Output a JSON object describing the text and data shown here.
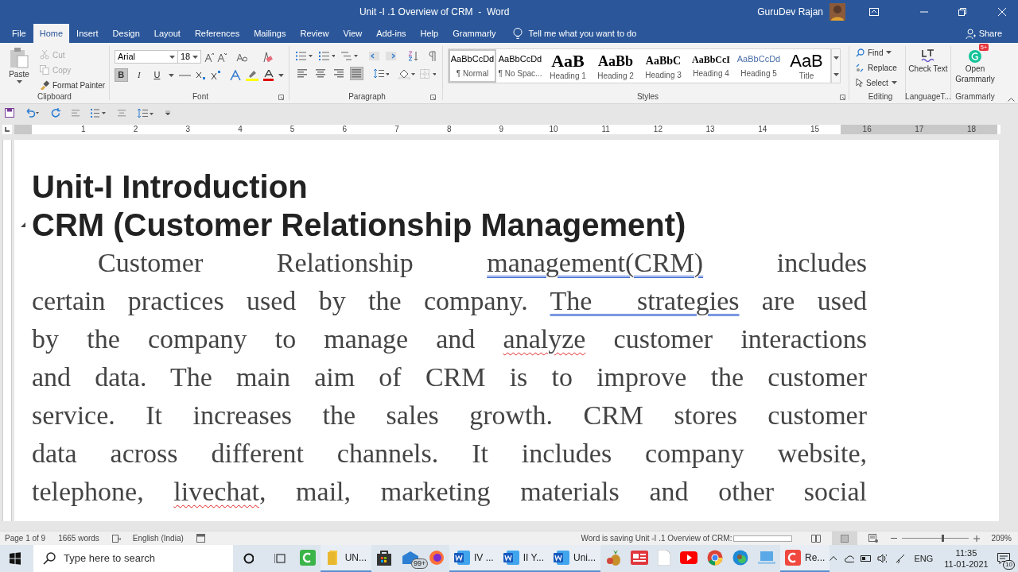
{
  "window": {
    "title": "Unit -I .1 Overview of CRM  -  Word",
    "user": "GuruDev Rajan"
  },
  "menu_tabs": [
    {
      "label": "File",
      "selected": false
    },
    {
      "label": "Home",
      "selected": true
    },
    {
      "label": "Insert",
      "selected": false
    },
    {
      "label": "Design",
      "selected": false
    },
    {
      "label": "Layout",
      "selected": false
    },
    {
      "label": "References",
      "selected": false
    },
    {
      "label": "Mailings",
      "selected": false
    },
    {
      "label": "Review",
      "selected": false
    },
    {
      "label": "View",
      "selected": false
    },
    {
      "label": "Add-ins",
      "selected": false
    },
    {
      "label": "Help",
      "selected": false
    },
    {
      "label": "Grammarly",
      "selected": false
    }
  ],
  "tell_me": "Tell me what you want to do",
  "share": "Share",
  "clipboard": {
    "paste": "Paste",
    "items": [
      {
        "kind": "cut",
        "label": "Cut",
        "disabled": true
      },
      {
        "kind": "copy",
        "label": "Copy",
        "disabled": true
      },
      {
        "kind": "painter",
        "label": "Format Painter",
        "disabled": false
      }
    ],
    "label": "Clipboard"
  },
  "font": {
    "name": "Arial",
    "size": "18",
    "label": "Font",
    "formats": [
      {
        "kind": "bold",
        "label": "B",
        "on": true
      },
      {
        "kind": "italic",
        "label": "I",
        "on": false
      },
      {
        "kind": "underline",
        "label": "U",
        "on": false
      }
    ]
  },
  "paragraph": {
    "label": "Paragraph",
    "alignments": [
      {
        "kind": "left",
        "selected": false
      },
      {
        "kind": "center",
        "selected": false
      },
      {
        "kind": "right",
        "selected": false
      },
      {
        "kind": "justify",
        "selected": true
      }
    ]
  },
  "styles": {
    "label": "Styles",
    "items": [
      {
        "kind": "normal",
        "preview": "AaBbCcDd",
        "name": "¶ Normal",
        "selected": true
      },
      {
        "kind": "nospacing",
        "preview": "AaBbCcDd",
        "name": "¶ No Spac...",
        "selected": false
      },
      {
        "kind": "h1",
        "preview": "AaB",
        "name": "Heading 1",
        "selected": false
      },
      {
        "kind": "h2",
        "preview": "AaBb",
        "name": "Heading 2",
        "selected": false
      },
      {
        "kind": "h3",
        "preview": "AaBbC",
        "name": "Heading 3",
        "selected": false
      },
      {
        "kind": "h4",
        "preview": "AaBbCcI",
        "name": "Heading 4",
        "selected": false
      },
      {
        "kind": "h5",
        "preview": "AaBbCcDd",
        "name": "Heading 5",
        "selected": false
      },
      {
        "kind": "title",
        "preview": "AaB",
        "name": "Title",
        "selected": false
      }
    ]
  },
  "editing": {
    "label": "Editing",
    "find": "Find",
    "replace": "Replace",
    "select": "Select"
  },
  "language_tool": {
    "button": "Check Text",
    "label": "LanguageT..."
  },
  "grammarly": {
    "button": "Open Grammarly",
    "badge": "5+",
    "label": "Grammarly"
  },
  "ruler": [
    "1",
    "2",
    "3",
    "4",
    "5",
    "6",
    "7",
    "8",
    "9",
    "10",
    "11",
    "12",
    "13",
    "14",
    "15",
    "16",
    "17",
    "18"
  ],
  "document": {
    "headings": [
      "Unit-I Introduction",
      "CRM (Customer Relationship Management)"
    ],
    "lines": [
      [
        {
          "text": "Customer Relationship "
        },
        {
          "text": "management(CRM)",
          "grammar_error": true
        },
        {
          "text": " includes"
        }
      ],
      [
        {
          "text": "certain practices used by the company. "
        },
        {
          "text": "The  strategies",
          "grammar_error": true
        },
        {
          "text": " are used"
        }
      ],
      [
        {
          "text": "by the company to manage and "
        },
        {
          "text": "analyze",
          "spelling_error": true
        },
        {
          "text": " customer interactions"
        }
      ],
      [
        {
          "text": "and data. The main aim of CRM is to improve the customer"
        }
      ],
      [
        {
          "text": "service. It increases the sales growth. CRM stores customer"
        }
      ],
      [
        {
          "text": "data across different channels. It includes company website,"
        }
      ],
      [
        {
          "text": "telephone, "
        },
        {
          "text": "livechat",
          "spelling_error": true
        },
        {
          "text": ", mail, marketing materials and other social"
        }
      ]
    ]
  },
  "status_bar": {
    "page": "Page 1 of 9",
    "words": "1665 words",
    "language": "English (India)",
    "saving": "Word is saving Unit -I .1 Overview of CRM:",
    "zoom": {
      "value": "209%",
      "level": 0.6
    }
  },
  "taskbar": {
    "search": {
      "placeholder": "Type here to search"
    },
    "apps": [
      {
        "kind": "camtasia",
        "active": false
      },
      {
        "kind": "folder",
        "label": "UN...",
        "active": true
      },
      {
        "kind": "store",
        "active": false
      },
      {
        "kind": "mail",
        "badge": "99+",
        "active": false
      },
      {
        "kind": "firefox",
        "active": false
      },
      {
        "kind": "word",
        "label": "IV ...",
        "active": true
      },
      {
        "kind": "word",
        "label": "II Y...",
        "active": true
      },
      {
        "kind": "word",
        "label": "Uni...",
        "active": true
      },
      {
        "kind": "fruit",
        "active": false
      },
      {
        "kind": "news",
        "active": false
      },
      {
        "kind": "file",
        "active": false
      },
      {
        "kind": "youtube",
        "active": false
      },
      {
        "kind": "chrome",
        "active": false
      },
      {
        "kind": "edge",
        "active": false
      },
      {
        "kind": "laptop",
        "active": false
      },
      {
        "kind": "recorder",
        "label": "Re...",
        "active": true
      }
    ],
    "language": "ENG",
    "time": "11:35",
    "date": "11-01-2021",
    "notifications": "10"
  }
}
